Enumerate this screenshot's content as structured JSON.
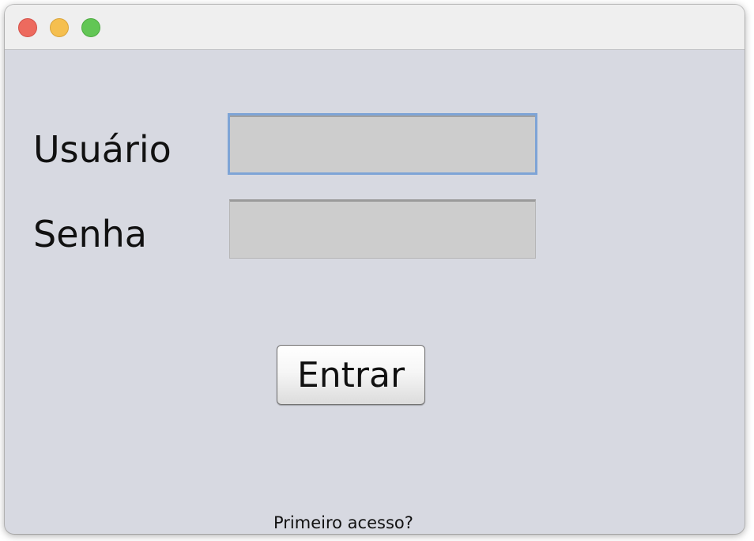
{
  "window": {
    "controls": [
      {
        "name": "close",
        "color": "#ed6a5e"
      },
      {
        "name": "minimize",
        "color": "#f5bf4f"
      },
      {
        "name": "zoom",
        "color": "#62c655"
      }
    ]
  },
  "login": {
    "user_label": "Usuário",
    "user_value": "",
    "password_label": "Senha",
    "password_value": "",
    "submit_label": "Entrar",
    "first_access_label": "Primeiro acesso?"
  },
  "colors": {
    "window_background": "#d7d9e1",
    "field_background": "#cdcdcd",
    "focus_ring": "#7ea4d6"
  }
}
